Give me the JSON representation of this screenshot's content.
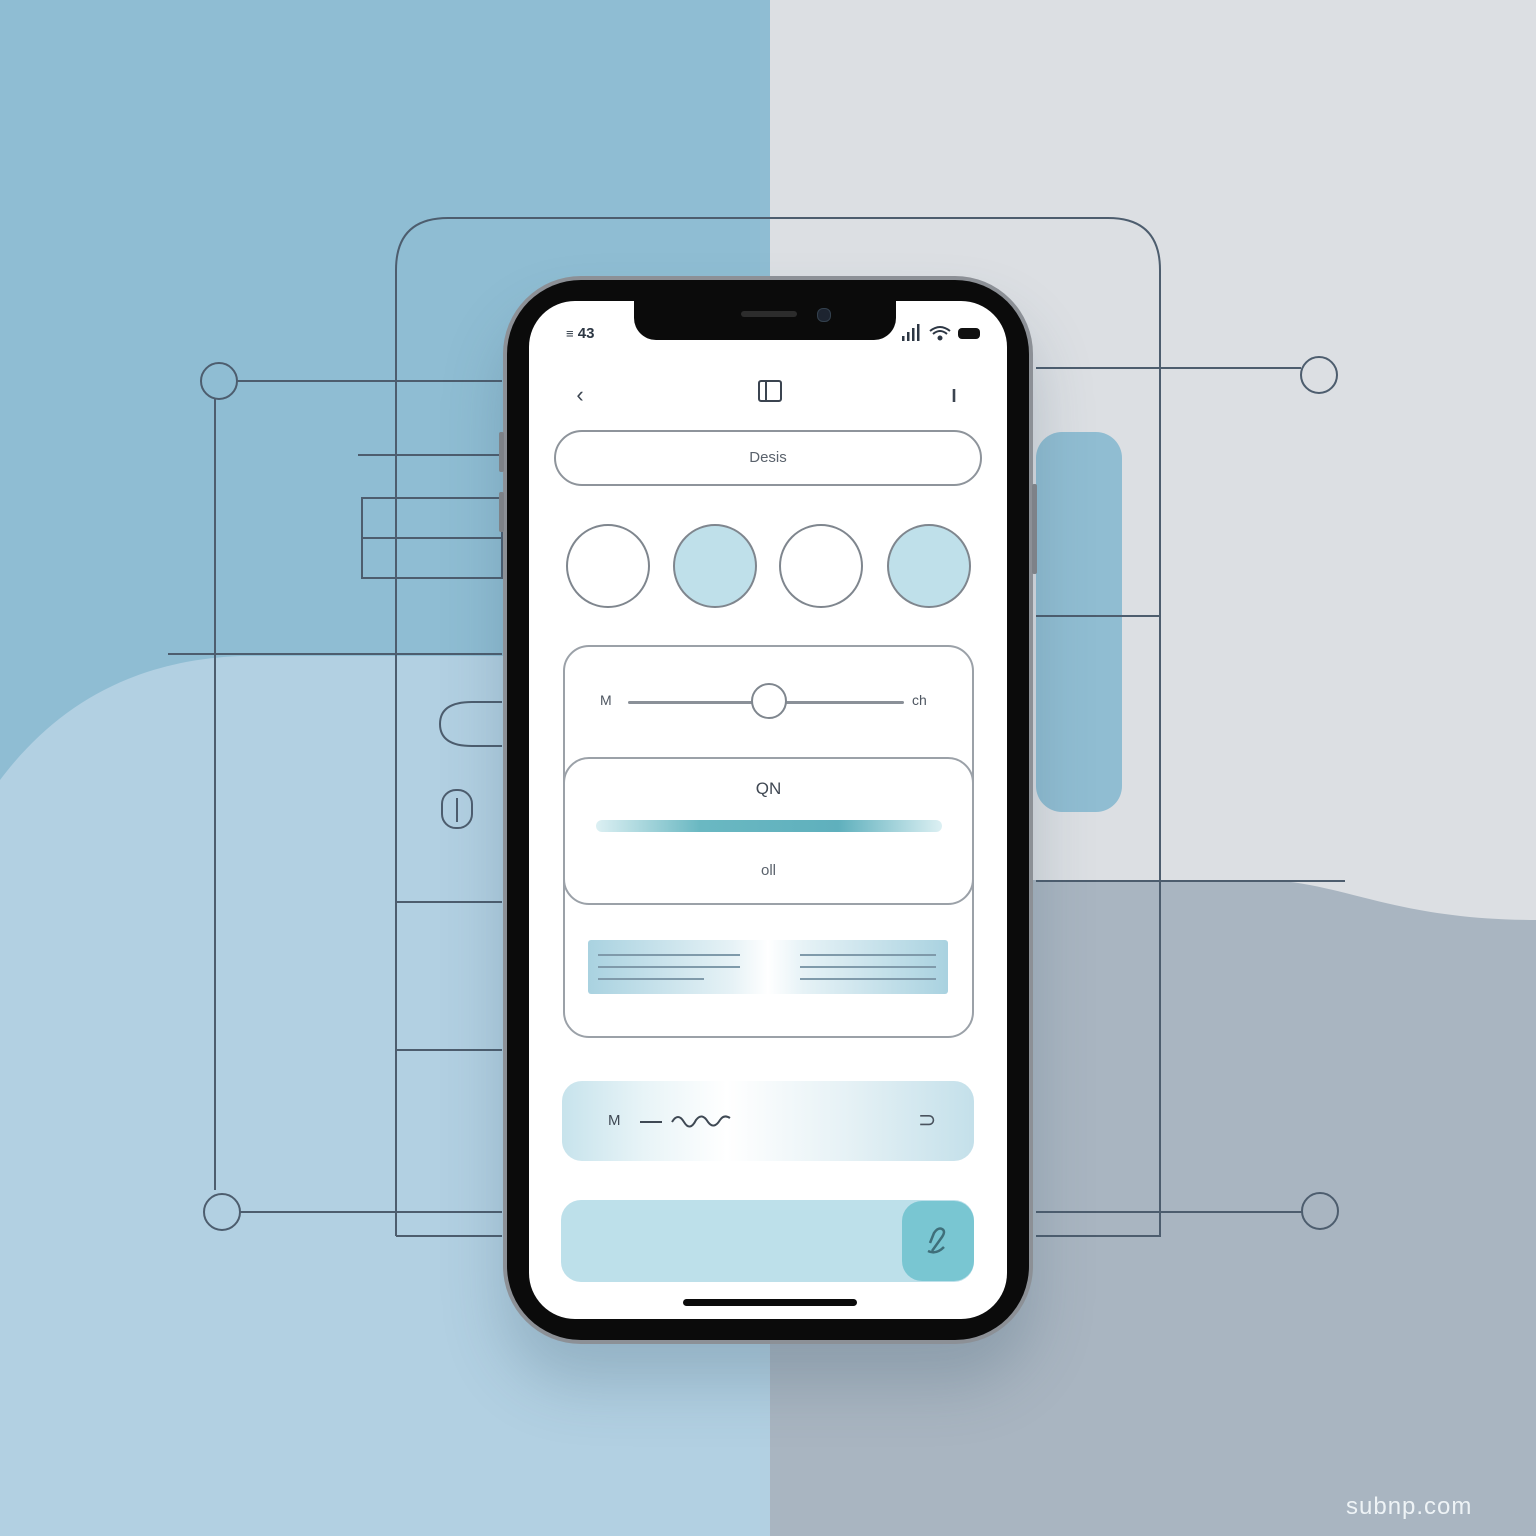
{
  "status_bar": {
    "time": "43",
    "icons": [
      "signal-icon",
      "wifi-icon",
      "battery-icon"
    ]
  },
  "nav": {
    "back_icon": "chevron-left-icon",
    "center_icon": "book-icon",
    "menu_label": "I"
  },
  "search": {
    "placeholder": "Desis"
  },
  "circles": {
    "states": [
      "empty",
      "filled",
      "empty",
      "filled"
    ]
  },
  "slider": {
    "min_label": "M",
    "max_label": "ch",
    "value": 0.5
  },
  "panel": {
    "title": "QN",
    "sub_label": "oll",
    "bar_level": 1.0
  },
  "row": {
    "label": "M",
    "chevron": "⊃"
  },
  "watermark": "subnp.com",
  "colors": {
    "accent": "#79c6d2",
    "accent_light": "#bde0ea",
    "bg_blue": "#8fbdd3",
    "bg_gray": "#dcdfe3",
    "line": "#4d5d6e"
  }
}
